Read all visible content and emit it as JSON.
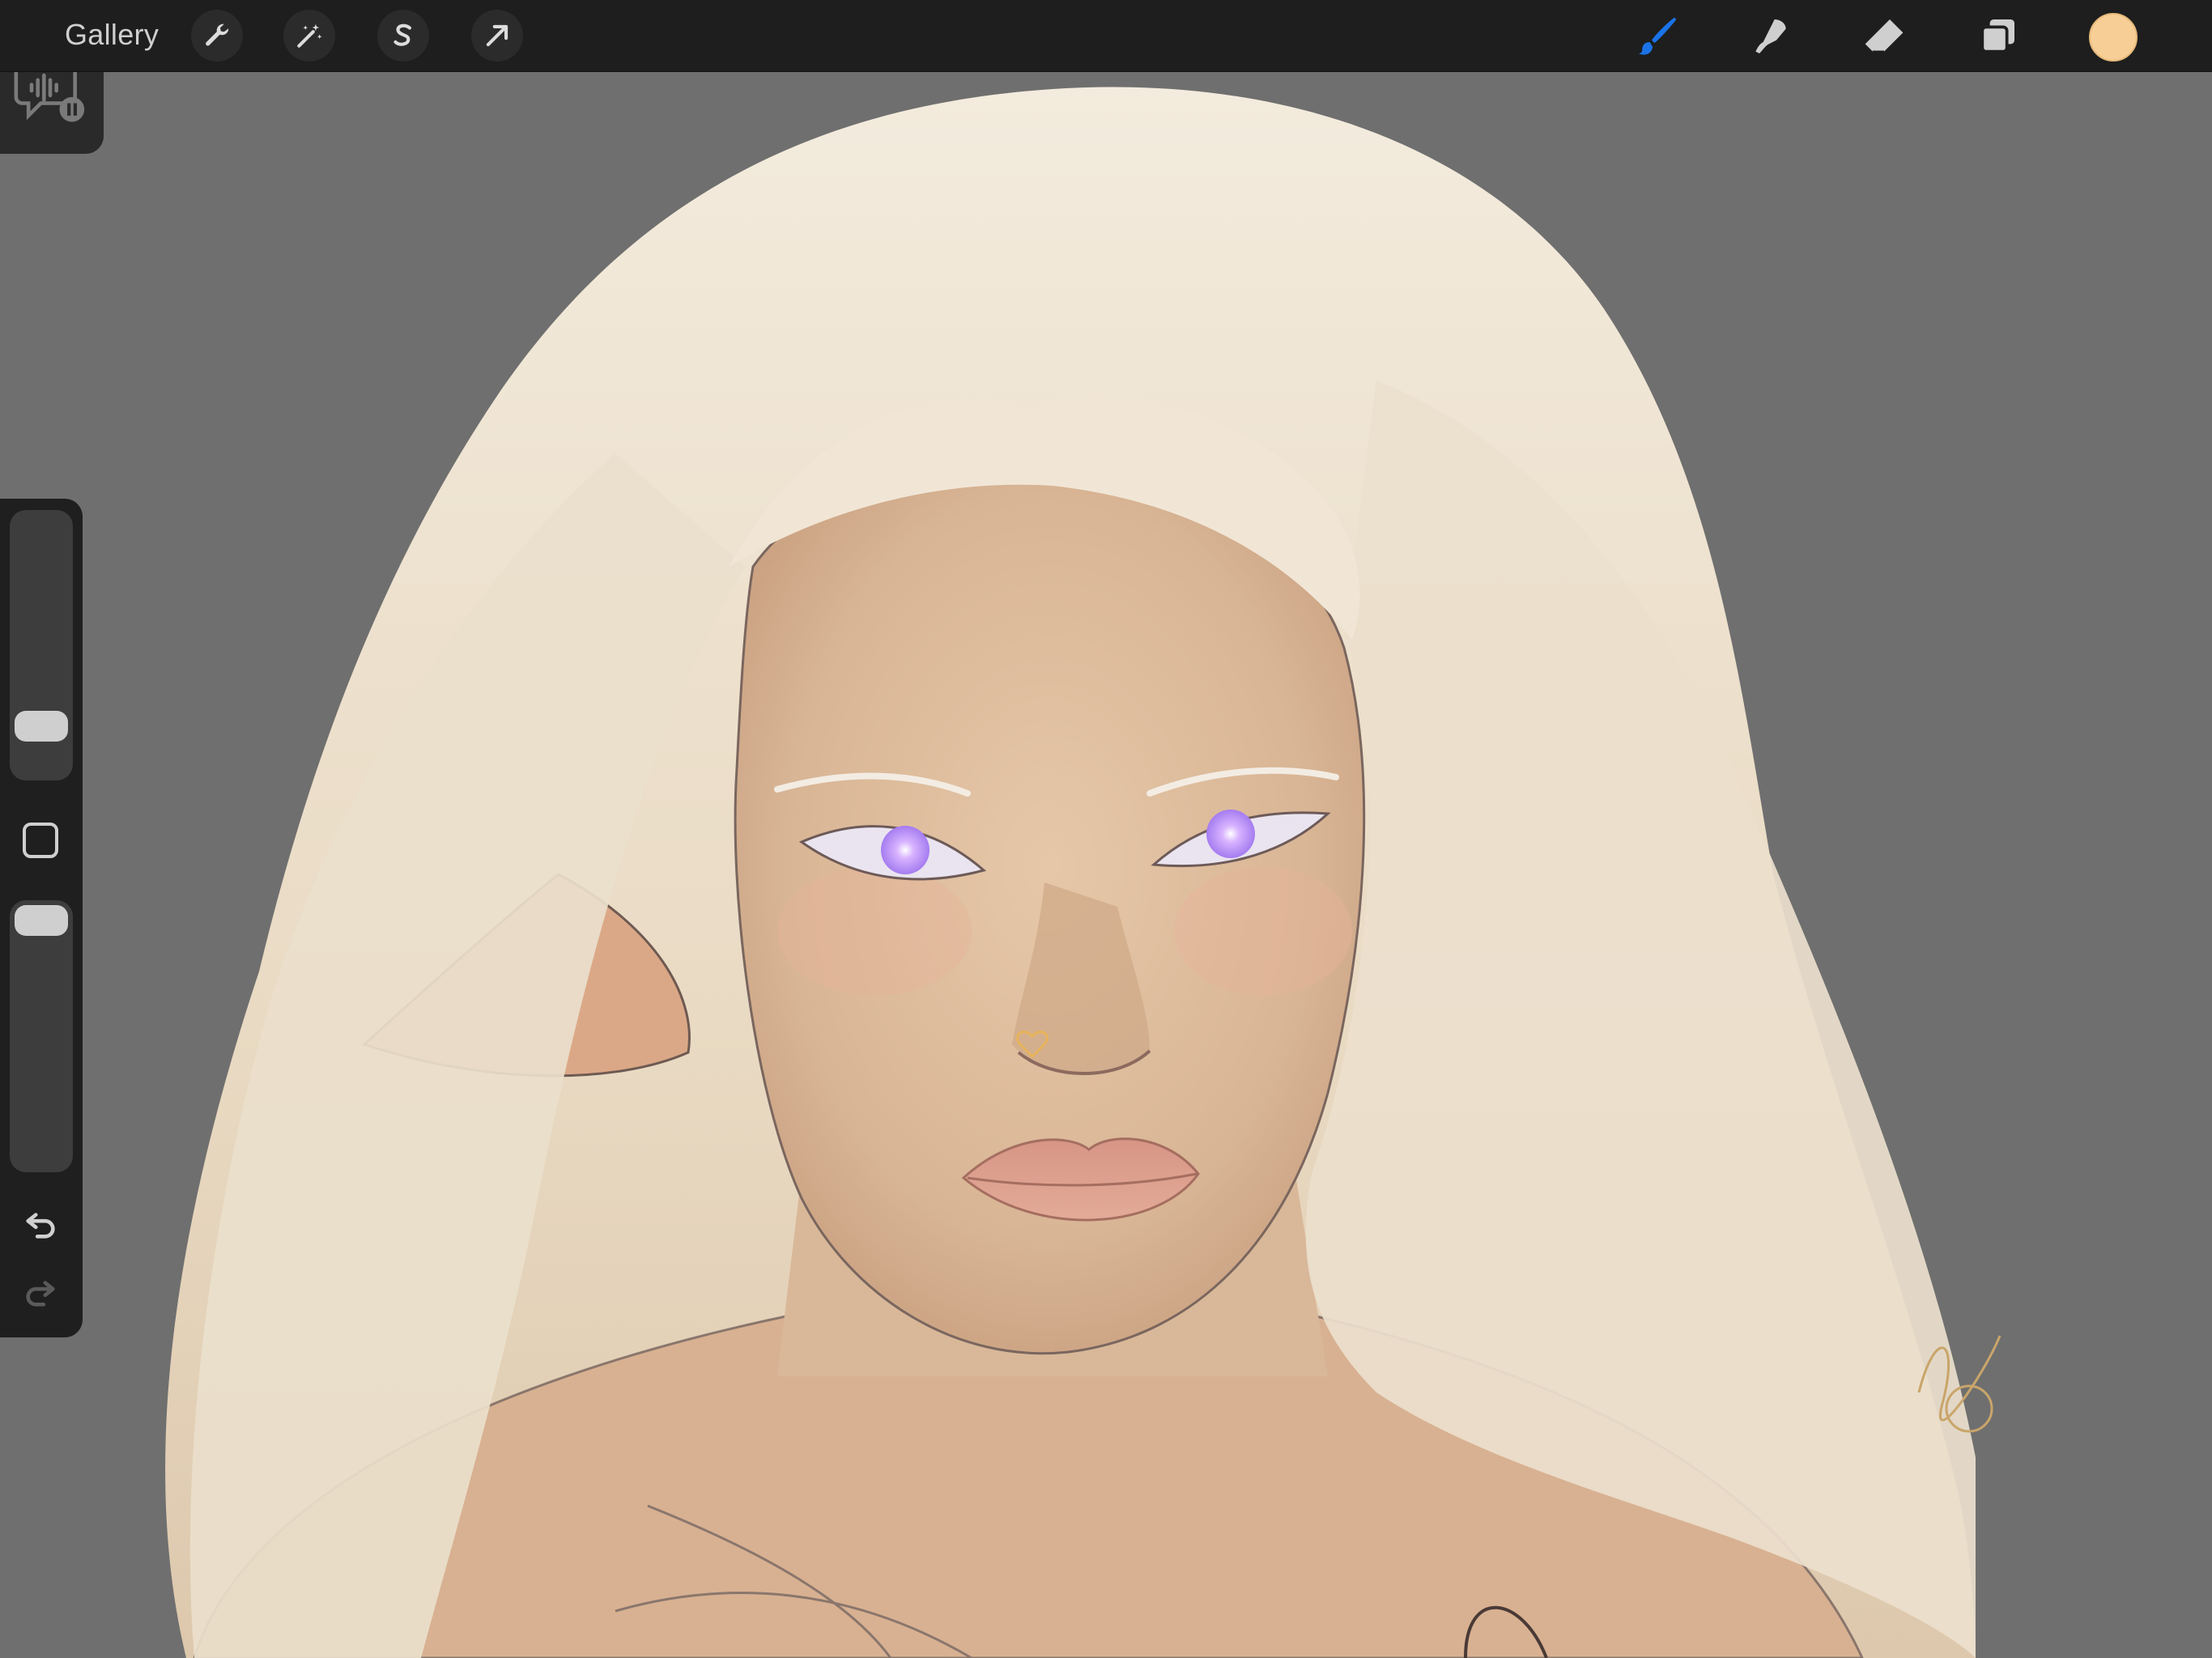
{
  "topbar": {
    "gallery_label": "Gallery",
    "tools_left": [
      {
        "name": "actions-wrench-icon"
      },
      {
        "name": "adjustments-wand-icon"
      },
      {
        "name": "selection-s-icon"
      },
      {
        "name": "transform-arrow-icon"
      }
    ],
    "tools_right": [
      {
        "name": "brush-icon",
        "active": true,
        "color": "#1a73e8"
      },
      {
        "name": "smudge-icon"
      },
      {
        "name": "eraser-icon"
      },
      {
        "name": "layers-icon"
      }
    ],
    "current_color": "#f7cf96"
  },
  "recording": {
    "icon": "voice-memo-paused-icon"
  },
  "sidebar": {
    "brush_size_level": 0.78,
    "opacity_level": 0.06,
    "modify_button_icon": "square-icon",
    "undo_icon": "undo-arrow-icon",
    "redo_icon": "redo-arrow-icon"
  },
  "artwork": {
    "subject": "",
    "background_color": "#6f6f6f",
    "hair_color": "#efe3cf",
    "skin_color": "#dfbf9f",
    "eye_color": "#c79bff",
    "lip_color": "#d79a88"
  }
}
